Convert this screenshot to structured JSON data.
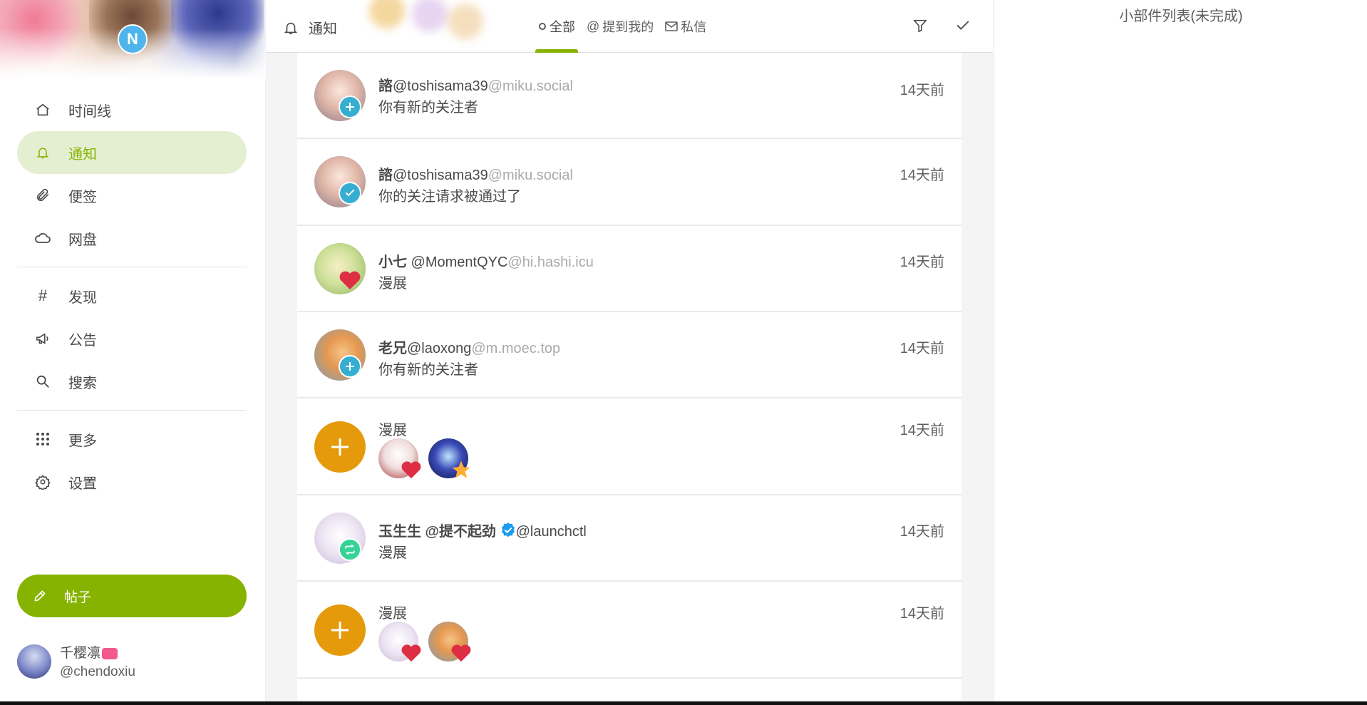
{
  "sidebar": {
    "logo_letter": "N",
    "nav": [
      {
        "label": "时间线",
        "icon": "home-icon"
      },
      {
        "label": "通知",
        "icon": "bell-icon",
        "active": true
      },
      {
        "label": "便签",
        "icon": "paperclip-icon"
      },
      {
        "label": "网盘",
        "icon": "cloud-icon"
      }
    ],
    "nav2": [
      {
        "label": "发现",
        "icon": "hash-icon"
      },
      {
        "label": "公告",
        "icon": "megaphone-icon"
      },
      {
        "label": "搜索",
        "icon": "search-icon"
      }
    ],
    "nav3": [
      {
        "label": "更多",
        "icon": "grid-dots-icon"
      },
      {
        "label": "设置",
        "icon": "gear-icon"
      }
    ],
    "post_label": "帖子",
    "account": {
      "name": "千樱凛",
      "handle": "@chendoxiu"
    }
  },
  "header": {
    "title": "通知",
    "tabs": [
      {
        "label": "全部",
        "icon": "circle-icon",
        "active": true
      },
      {
        "label": "提到我的",
        "icon": "at-icon"
      },
      {
        "label": "私信",
        "icon": "mail-icon"
      }
    ]
  },
  "notifications": [
    {
      "name": "諮",
      "handle": "@toshisama39",
      "host": "@miku.social",
      "text": "你有新的关注者",
      "time": "14天前",
      "badge": "follow"
    },
    {
      "name": "諮",
      "handle": "@toshisama39",
      "host": "@miku.social",
      "text": "你的关注请求被通过了",
      "time": "14天前",
      "badge": "accepted"
    },
    {
      "name": "小七",
      "handle": " @MomentQYC",
      "host": "@hi.hashi.icu",
      "text": "漫展",
      "time": "14天前",
      "badge": "reaction-heart"
    },
    {
      "name": "老兄",
      "handle": "@laoxong",
      "host": "@m.moec.top",
      "text": "你有新的关注者",
      "time": "14天前",
      "badge": "follow"
    },
    {
      "group": true,
      "text": "漫展",
      "time": "14天前"
    },
    {
      "name": "玉生生 @提不起劲 ",
      "handle": "@launchctl",
      "host": "",
      "text": "漫展",
      "time": "14天前",
      "badge": "renote"
    },
    {
      "group": true,
      "text": "漫展",
      "time": "14天前"
    }
  ],
  "widgets": {
    "title": "小部件列表(未完成)"
  },
  "colors": {
    "accent": "#86b300",
    "follow": "#36aed2",
    "heart": "#dd2e44",
    "star": "#ffac33",
    "renote": "#36d298",
    "group": "#e59a0c"
  }
}
